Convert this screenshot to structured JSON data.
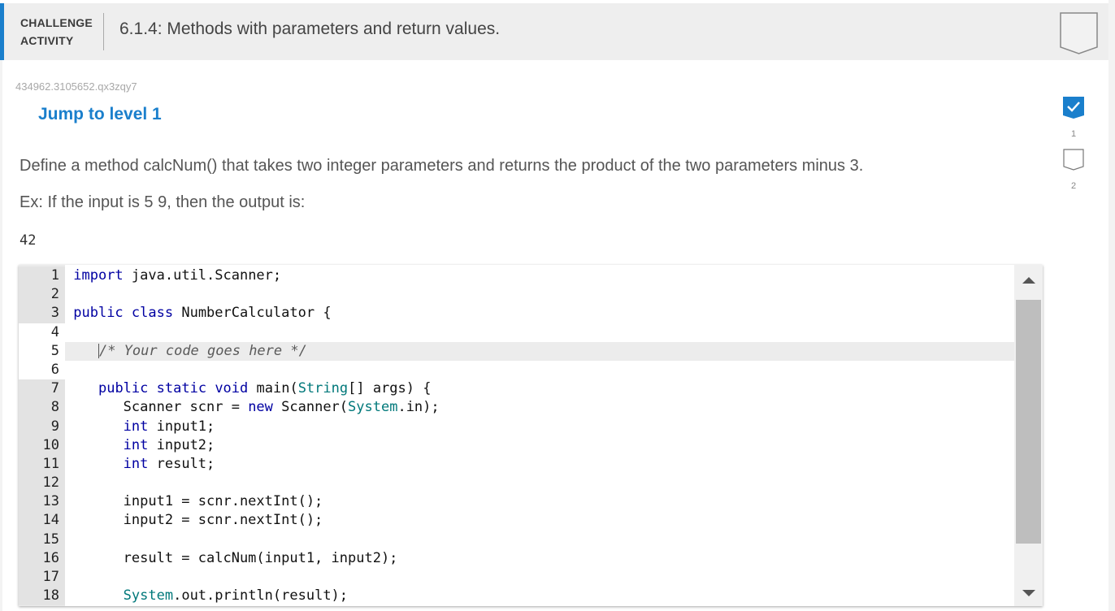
{
  "header": {
    "tag_line1": "CHALLENGE",
    "tag_line2": "ACTIVITY",
    "title": "6.1.4: Methods with parameters and return values.",
    "completion_badge": "incomplete"
  },
  "activity": {
    "id": "434962.3105652.qx3zqy7",
    "jump_label": "Jump to level 1",
    "instructions": "Define a method calcNum() that takes two integer parameters and returns the product of the two parameters minus 3.",
    "example_text": "Ex: If the input is 5 9, then the output is:",
    "example_output": "42"
  },
  "levels": [
    {
      "number": "1",
      "status": "complete",
      "icon": "check-icon"
    },
    {
      "number": "2",
      "status": "incomplete",
      "icon": "empty-badge-icon"
    }
  ],
  "colors": {
    "accent": "#1a7fcc",
    "keyword": "#0000a2",
    "type": "#00787a"
  },
  "editor": {
    "lines": [
      {
        "n": "1",
        "readonly": true,
        "tokens": [
          {
            "t": "import",
            "c": "kw"
          },
          {
            "t": " java.util.Scanner;",
            "c": ""
          }
        ]
      },
      {
        "n": "2",
        "readonly": true,
        "tokens": []
      },
      {
        "n": "3",
        "readonly": true,
        "tokens": [
          {
            "t": "public",
            "c": "kw"
          },
          {
            "t": " ",
            "c": ""
          },
          {
            "t": "class",
            "c": "kw"
          },
          {
            "t": " NumberCalculator {",
            "c": ""
          }
        ]
      },
      {
        "n": "4",
        "readonly": false,
        "tokens": []
      },
      {
        "n": "5",
        "readonly": false,
        "active": true,
        "caret": true,
        "tokens": [
          {
            "t": "   ",
            "c": ""
          },
          {
            "t": "/* Your code goes here */",
            "c": "cm"
          }
        ]
      },
      {
        "n": "6",
        "readonly": false,
        "tokens": []
      },
      {
        "n": "7",
        "readonly": true,
        "tokens": [
          {
            "t": "   ",
            "c": ""
          },
          {
            "t": "public",
            "c": "kw"
          },
          {
            "t": " ",
            "c": ""
          },
          {
            "t": "static",
            "c": "kw"
          },
          {
            "t": " ",
            "c": ""
          },
          {
            "t": "void",
            "c": "kw"
          },
          {
            "t": " main(",
            "c": ""
          },
          {
            "t": "String",
            "c": "ty"
          },
          {
            "t": "[] args) {",
            "c": ""
          }
        ]
      },
      {
        "n": "8",
        "readonly": true,
        "tokens": [
          {
            "t": "      Scanner scnr = ",
            "c": ""
          },
          {
            "t": "new",
            "c": "kw"
          },
          {
            "t": " Scanner(",
            "c": ""
          },
          {
            "t": "System",
            "c": "ty"
          },
          {
            "t": ".in);",
            "c": ""
          }
        ]
      },
      {
        "n": "9",
        "readonly": true,
        "tokens": [
          {
            "t": "      ",
            "c": ""
          },
          {
            "t": "int",
            "c": "kw"
          },
          {
            "t": " input1;",
            "c": ""
          }
        ]
      },
      {
        "n": "10",
        "readonly": true,
        "tokens": [
          {
            "t": "      ",
            "c": ""
          },
          {
            "t": "int",
            "c": "kw"
          },
          {
            "t": " input2;",
            "c": ""
          }
        ]
      },
      {
        "n": "11",
        "readonly": true,
        "tokens": [
          {
            "t": "      ",
            "c": ""
          },
          {
            "t": "int",
            "c": "kw"
          },
          {
            "t": " result;",
            "c": ""
          }
        ]
      },
      {
        "n": "12",
        "readonly": true,
        "tokens": []
      },
      {
        "n": "13",
        "readonly": true,
        "tokens": [
          {
            "t": "      input1 = scnr.nextInt();",
            "c": ""
          }
        ]
      },
      {
        "n": "14",
        "readonly": true,
        "tokens": [
          {
            "t": "      input2 = scnr.nextInt();",
            "c": ""
          }
        ]
      },
      {
        "n": "15",
        "readonly": true,
        "tokens": []
      },
      {
        "n": "16",
        "readonly": true,
        "tokens": [
          {
            "t": "      result = calcNum(input1, input2);",
            "c": ""
          }
        ]
      },
      {
        "n": "17",
        "readonly": true,
        "tokens": []
      },
      {
        "n": "18",
        "readonly": true,
        "tokens": [
          {
            "t": "      ",
            "c": ""
          },
          {
            "t": "System",
            "c": "ty"
          },
          {
            "t": ".out.println(result);",
            "c": ""
          }
        ]
      }
    ]
  }
}
